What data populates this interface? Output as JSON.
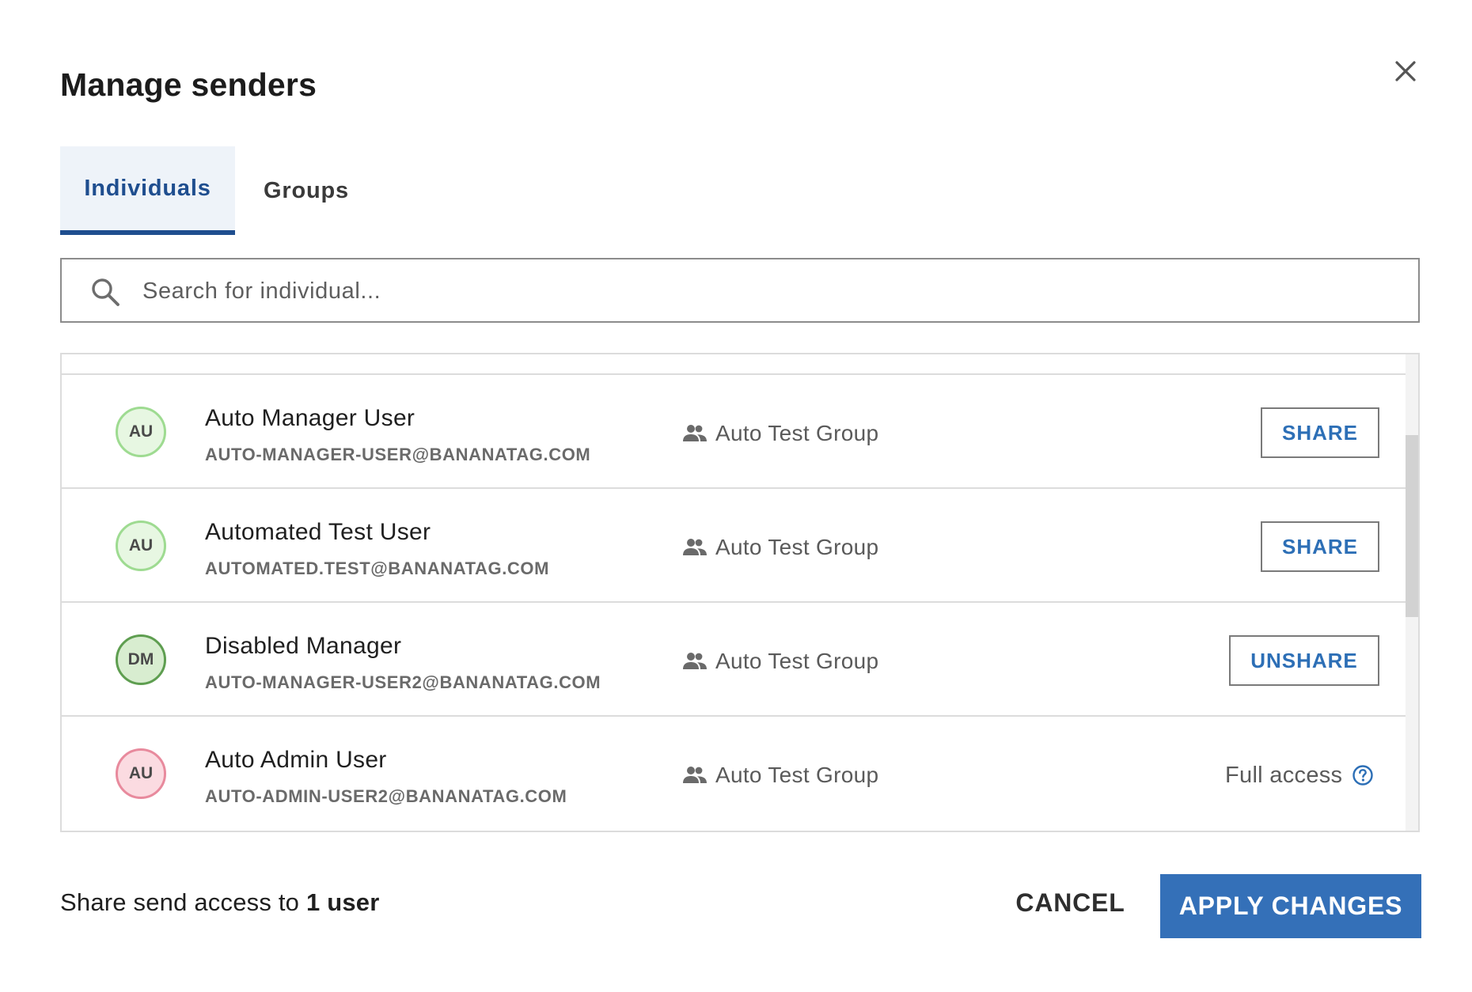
{
  "dialog": {
    "title": "Manage senders",
    "close_icon": "close-icon"
  },
  "tabs": [
    {
      "label": "Individuals",
      "active": true
    },
    {
      "label": "Groups",
      "active": false
    }
  ],
  "search": {
    "placeholder": "Search for individual...",
    "value": "",
    "icon": "search-icon"
  },
  "users": [
    {
      "initials": "AU",
      "name": "Auto Manager User",
      "email": "AUTO-MANAGER-USER@BANANATAG.COM",
      "group": "Auto Test Group",
      "action": "SHARE",
      "avatar_color": "#9edb91"
    },
    {
      "initials": "AU",
      "name": "Automated Test User",
      "email": "AUTOMATED.TEST@BANANATAG.COM",
      "group": "Auto Test Group",
      "action": "SHARE",
      "avatar_color": "#9edb91"
    },
    {
      "initials": "DM",
      "name": "Disabled Manager",
      "email": "AUTO-MANAGER-USER2@BANANATAG.COM",
      "group": "Auto Test Group",
      "action": "UNSHARE",
      "avatar_color": "#5e9e50"
    },
    {
      "initials": "AU",
      "name": "Auto Admin User",
      "email": "AUTO-ADMIN-USER2@BANANATAG.COM",
      "group": "Auto Test Group",
      "status": "Full access",
      "avatar_color": "#e88a9d"
    }
  ],
  "footer": {
    "summary_prefix": "Share send access to ",
    "summary_count": "1 user",
    "cancel_label": "CANCEL",
    "apply_label": "APPLY CHANGES"
  },
  "colors": {
    "accent": "#3470b8",
    "active_tab": "#1f4e8f",
    "link": "#2d6fb6"
  }
}
